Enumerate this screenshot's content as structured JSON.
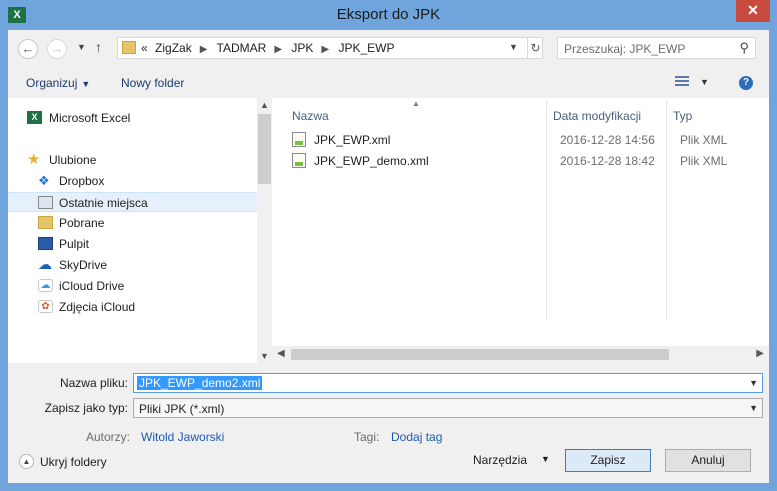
{
  "window": {
    "title": "Eksport do JPK",
    "app_icon": "excel-icon",
    "close_glyph": "✕"
  },
  "address": {
    "back_glyph": "←",
    "forward_glyph": "→",
    "up_glyph": "↑",
    "prefix": "«",
    "crumbs": [
      "ZigZak",
      "TADMAR",
      "JPK",
      "JPK_EWP"
    ],
    "refresh_glyph": "↻"
  },
  "search": {
    "placeholder": "Przeszukaj: JPK_EWP",
    "icon": "search-icon"
  },
  "toolbar": {
    "organize_label": "Organizuj",
    "new_folder_label": "Nowy folder",
    "help_glyph": "?"
  },
  "nav": {
    "items": [
      {
        "label": "Microsoft Excel",
        "icon": "excel-icon"
      },
      {
        "label": "Ulubione",
        "icon": "star-icon"
      },
      {
        "label": "Dropbox",
        "icon": "dropbox-icon"
      },
      {
        "label": "Ostatnie miejsca",
        "icon": "recent-places-icon",
        "selected": true
      },
      {
        "label": "Pobrane",
        "icon": "downloads-icon"
      },
      {
        "label": "Pulpit",
        "icon": "desktop-icon"
      },
      {
        "label": "SkyDrive",
        "icon": "skydrive-icon"
      },
      {
        "label": "iCloud Drive",
        "icon": "icloud-icon"
      },
      {
        "label": "Zdjęcia iCloud",
        "icon": "icloud-photos-icon"
      }
    ]
  },
  "files": {
    "columns": [
      "Nazwa",
      "Data modyfikacji",
      "Typ"
    ],
    "rows": [
      {
        "name": "JPK_EWP.xml",
        "date": "2016-12-28 14:56",
        "type": "Plik XML"
      },
      {
        "name": "JPK_EWP_demo.xml",
        "date": "2016-12-28 18:42",
        "type": "Plik XML"
      }
    ]
  },
  "form": {
    "filename_label": "Nazwa pliku:",
    "filename_value": "JPK_EWP_demo2.xml",
    "savetype_label": "Zapisz jako typ:",
    "savetype_value": "Pliki JPK (*.xml)",
    "authors_label": "Autorzy:",
    "authors_value": "Witold Jaworski",
    "tags_label": "Tagi:",
    "tags_value": "Dodaj tag"
  },
  "footer": {
    "hide_folders_label": "Ukryj foldery",
    "tools_label": "Narzędzia",
    "save_label": "Zapisz",
    "cancel_label": "Anuluj"
  },
  "colors": {
    "title_bar": "#6fa4dc",
    "selection": "#3399ff",
    "link": "#1e5ab4"
  }
}
